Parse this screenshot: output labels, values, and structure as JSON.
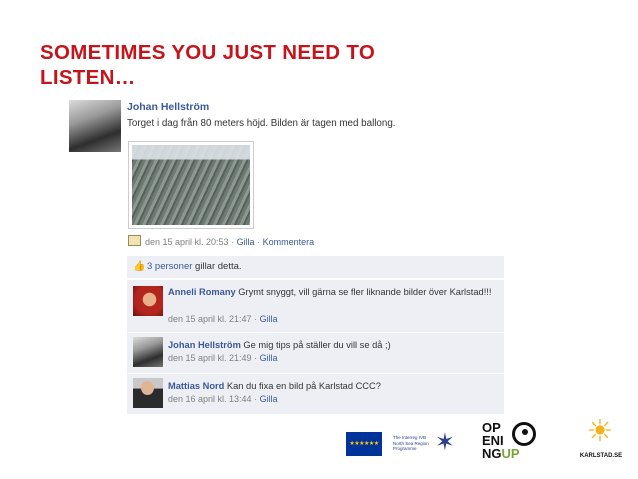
{
  "slide": {
    "title_line1": "SOMETIMES YOU JUST NEED TO",
    "title_line2": "LISTEN…"
  },
  "post": {
    "author": "Johan Hellström",
    "text": "Torget i dag från 80 meters höjd. Bilden är tagen med ballong.",
    "date": "den 15 april kl. 20:53",
    "sep1": " · ",
    "like": "Gilla",
    "sep2": " · ",
    "comment": "Kommentera",
    "likes_count": "3 personer",
    "likes_suffix": " gillar detta."
  },
  "comments": [
    {
      "author": "Anneli Romany",
      "text": " Grymt snyggt, vill gärna se fler liknande bilder över Karlstad!!!",
      "date": "den 15 april kl. 21:47",
      "sep": " · ",
      "like": "Gilla"
    },
    {
      "author": "Johan Hellström",
      "text": " Ge mig tips på ställer du vill se då ;)",
      "date": "den 15 april kl. 21:49",
      "sep": " · ",
      "like": "Gilla"
    },
    {
      "author": "Mattias Nord",
      "text": " Kan du fixa en bild på Karlstad CCC?",
      "date": "den 16 april kl. 13:44",
      "sep": " · ",
      "like": "Gilla"
    }
  ],
  "logos": {
    "interreg_text": "The Interreg IVB North Sea Region Programme",
    "opening_l1": "OP",
    "opening_l2": "ENI",
    "opening_l3a": "NG",
    "opening_l3b": "UP",
    "karlstad": "KARLSTAD.SE"
  },
  "colors": {
    "title_red": "#c4151c",
    "fb_blue": "#3b5998",
    "comment_bg": "#edeff4"
  }
}
